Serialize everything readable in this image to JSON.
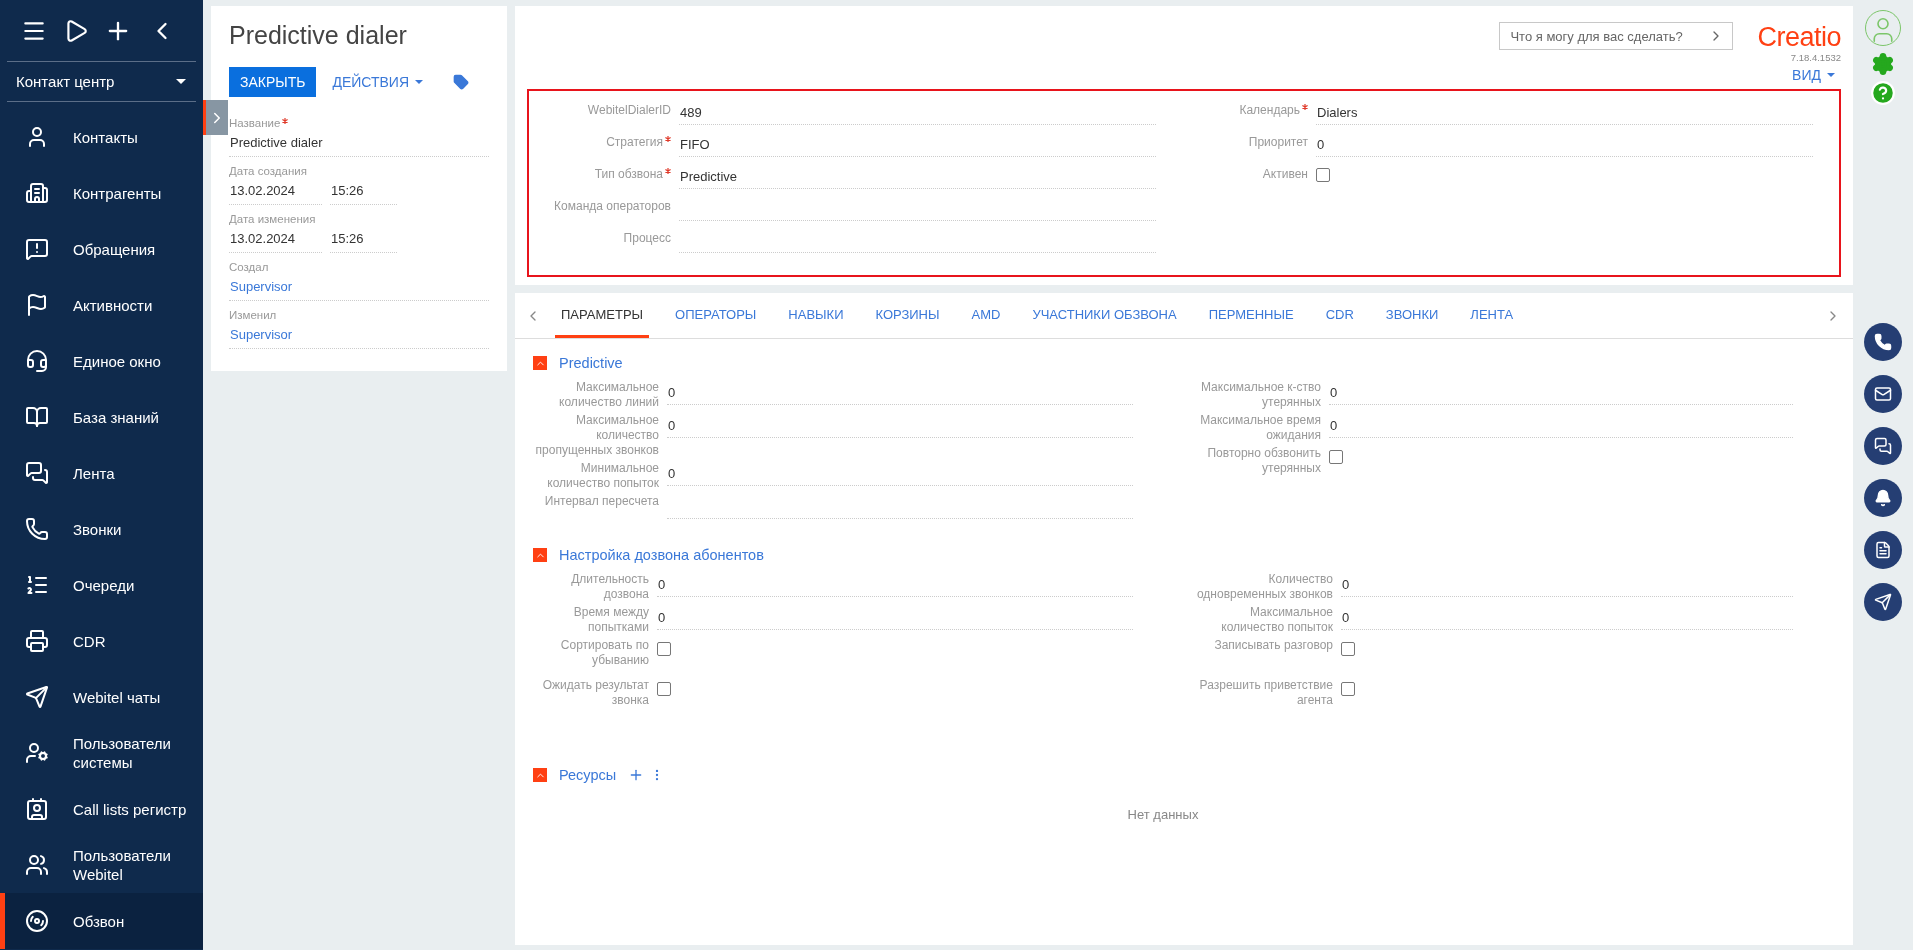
{
  "sidebar": {
    "workspace": "Контакт центр",
    "items": [
      {
        "label": "Контакты",
        "selected": false
      },
      {
        "label": "Контрагенты",
        "selected": false
      },
      {
        "label": "Обращения",
        "selected": false
      },
      {
        "label": "Активности",
        "selected": false
      },
      {
        "label": "Единое окно",
        "selected": false
      },
      {
        "label": "База знаний",
        "selected": false
      },
      {
        "label": "Лента",
        "selected": false
      },
      {
        "label": "Звонки",
        "selected": false
      },
      {
        "label": "Очереди",
        "selected": false
      },
      {
        "label": "CDR",
        "selected": false
      },
      {
        "label": "Webitel чаты",
        "selected": false
      },
      {
        "label": "Пользователи системы",
        "selected": false
      },
      {
        "label": "Call lists регистр",
        "selected": false
      },
      {
        "label": "Пользователи Webitel",
        "selected": false
      },
      {
        "label": "Обзвон",
        "selected": true
      }
    ]
  },
  "header": {
    "title": "Predictive dialer",
    "close_button": "ЗАКРЫТЬ",
    "actions_button": "ДЕЙСТВИЯ",
    "search": {
      "placeholder": "Что я могу для вас сделать?"
    },
    "logo": "Creatio",
    "version": "7.18.4.1532",
    "view_button": "ВИД"
  },
  "record_panel": [
    {
      "label": "Название",
      "required": true,
      "kind": "text",
      "value": "Predictive dialer"
    },
    {
      "label": "Дата создания",
      "required": false,
      "kind": "datetime",
      "value": "13.02.2024",
      "time": "15:26"
    },
    {
      "label": "Дата изменения",
      "required": false,
      "kind": "datetime",
      "value": "13.02.2024",
      "time": "15:26"
    },
    {
      "label": "Создал",
      "required": false,
      "kind": "link",
      "value": "Supervisor"
    },
    {
      "label": "Изменил",
      "required": false,
      "kind": "link",
      "value": "Supervisor"
    }
  ],
  "main_fields": {
    "left": [
      {
        "label": "WebitelDialerID",
        "required": false,
        "kind": "text",
        "value": "489"
      },
      {
        "label": "Стратегия",
        "required": true,
        "kind": "text",
        "value": "FIFO"
      },
      {
        "label": "Тип обзвона",
        "required": true,
        "kind": "text",
        "value": "Predictive"
      },
      {
        "label": "Команда операторов",
        "required": false,
        "kind": "text"
      },
      {
        "label": "Процесс",
        "required": false,
        "kind": "text"
      }
    ],
    "right": [
      {
        "label": "Календарь",
        "required": true,
        "kind": "text",
        "value": "Dialers"
      },
      {
        "label": "Приоритет",
        "required": false,
        "kind": "text",
        "value": "0"
      },
      {
        "label": "Активен",
        "required": false,
        "kind": "checkbox",
        "checked": false
      }
    ]
  },
  "tabs": [
    {
      "label": "ПАРАМЕТРЫ",
      "selected": true
    },
    {
      "label": "ОПЕРАТОРЫ",
      "selected": false
    },
    {
      "label": "НАВЫКИ",
      "selected": false
    },
    {
      "label": "КОРЗИНЫ",
      "selected": false
    },
    {
      "label": "AMD",
      "selected": false
    },
    {
      "label": "УЧАСТНИКИ ОБЗВОНА",
      "selected": false
    },
    {
      "label": "ПЕРМЕННЫЕ",
      "selected": false
    },
    {
      "label": "CDR",
      "selected": false
    },
    {
      "label": "ЗВОНКИ",
      "selected": false
    },
    {
      "label": "ЛЕНТА",
      "selected": false
    }
  ],
  "sections": [
    {
      "title": "Predictive",
      "expanded": true,
      "left": [
        {
          "label": "Максимальное количество линий",
          "kind": "text",
          "value": "0"
        },
        {
          "label": "Максимальное количество пропущенных звонков",
          "kind": "text",
          "value": "0"
        },
        {
          "label": "Минимальное количество попыток",
          "kind": "text",
          "value": "0"
        },
        {
          "label": "Интервал пересчета",
          "kind": "text"
        }
      ],
      "right": [
        {
          "label": "Максимальное к-ство утерянных",
          "kind": "text",
          "value": "0"
        },
        {
          "label": "Максимальное время ожидания",
          "kind": "text",
          "value": "0"
        },
        {
          "label": "Повторно обзвонить утерянных",
          "kind": "checkbox",
          "checked": false
        }
      ]
    },
    {
      "title": "Настройка дозвона абонентов",
      "expanded": true,
      "left": [
        {
          "label": "Длительность дозвона",
          "kind": "text",
          "value": "0"
        },
        {
          "label": "Время между попытками",
          "kind": "text",
          "value": "0"
        },
        {
          "label": "Сортировать по убыванию",
          "kind": "checkbox",
          "checked": false
        },
        {
          "label": "Ожидать результат звонка",
          "kind": "checkbox",
          "checked": false
        }
      ],
      "right": [
        {
          "label": "Количество одновременных звонков",
          "kind": "text",
          "value": "0"
        },
        {
          "label": "Максимальное количество попыток",
          "kind": "text",
          "value": "0"
        },
        {
          "label": "Записывать разговор",
          "kind": "checkbox",
          "checked": false
        },
        {
          "label": "Разрешить приветствие агента",
          "kind": "checkbox",
          "checked": false
        }
      ]
    }
  ],
  "resources": {
    "title": "Ресурсы",
    "expanded": true,
    "empty_text": "Нет данных"
  }
}
